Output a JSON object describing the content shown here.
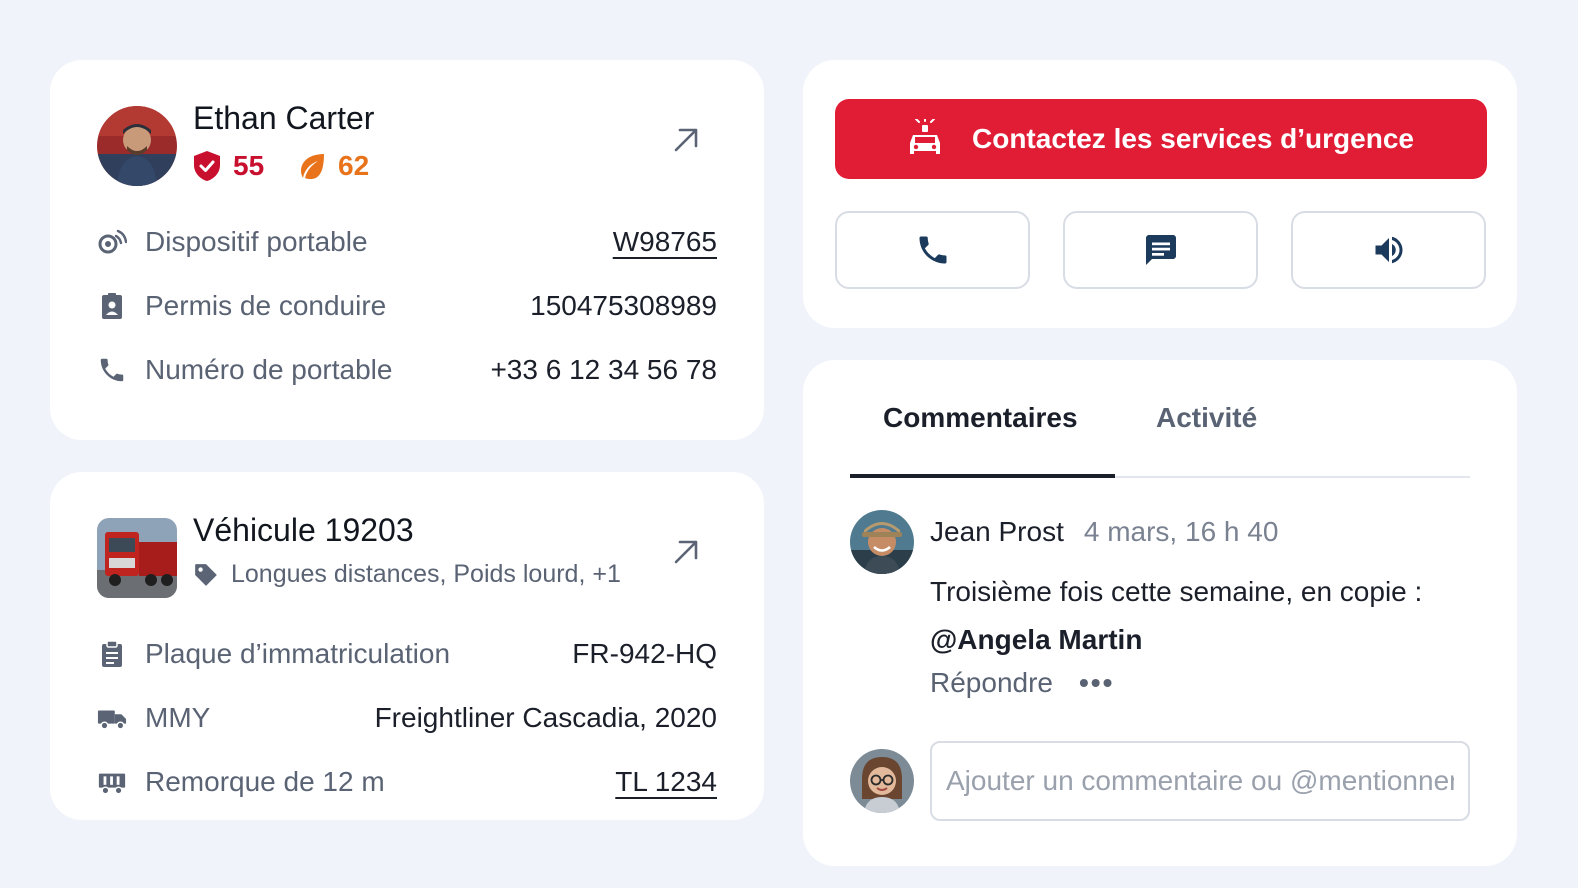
{
  "driver": {
    "name": "Ethan Carter",
    "safety_score": "55",
    "eco_score": "62",
    "rows": [
      {
        "icon": "wearable-device-icon",
        "label": "Dispositif portable",
        "value": "W98765"
      },
      {
        "icon": "id-badge-icon",
        "label": "Permis de conduire",
        "value": "150475308989"
      },
      {
        "icon": "phone-icon",
        "label": "Numéro de portable",
        "value": "+33 6 12 34 56 78"
      }
    ]
  },
  "vehicle": {
    "name": "Véhicule 19203",
    "tags": "Longues distances, Poids lourd, +1",
    "rows": [
      {
        "icon": "clipboard-icon",
        "label": "Plaque d’immatriculation",
        "value": "FR-942-HQ"
      },
      {
        "icon": "truck-icon",
        "label": "MMY",
        "value": "Freightliner Cascadia, 2020"
      },
      {
        "icon": "trailer-icon",
        "label": "Remorque de 12 m",
        "value": "TL 1234"
      }
    ]
  },
  "emergency": {
    "label": "Contactez les services d’urgence",
    "actions": [
      "phone-icon",
      "message-icon",
      "speaker-icon"
    ]
  },
  "comments": {
    "tabs": [
      "Commentaires",
      "Activité"
    ],
    "active_tab": "Commentaires",
    "author": "Jean Prost",
    "timestamp": "4 mars, 16 h 40",
    "text": "Troisième fois cette semaine, en copie :",
    "mention": "@Angela Martin",
    "reply_label": "Répondre",
    "more_label": "•••",
    "input_placeholder": "Ajouter un commentaire ou @mentionner"
  },
  "colors": {
    "safety": "#c8102e",
    "eco": "#e8731a",
    "emergency": "#e11d36",
    "accent_dark": "#1b3a5c"
  }
}
